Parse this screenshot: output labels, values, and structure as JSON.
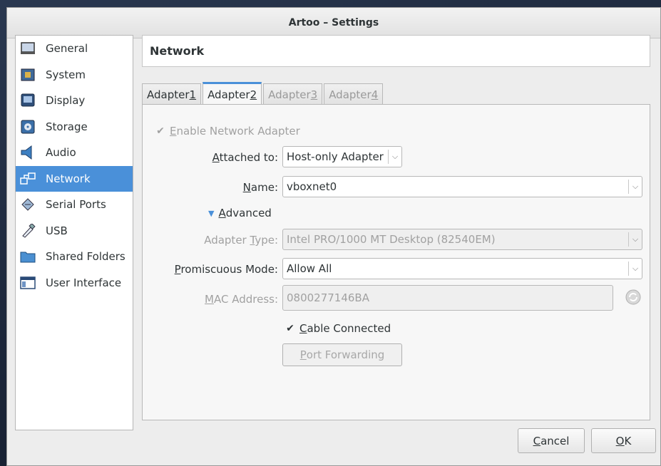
{
  "window": {
    "title": "Artoo – Settings"
  },
  "sidebar": {
    "items": [
      {
        "label": "General",
        "icon": "monitor-icon"
      },
      {
        "label": "System",
        "icon": "chip-icon"
      },
      {
        "label": "Display",
        "icon": "display-icon"
      },
      {
        "label": "Storage",
        "icon": "storage-icon"
      },
      {
        "label": "Audio",
        "icon": "speaker-icon"
      },
      {
        "label": "Network",
        "icon": "network-icon",
        "selected": true
      },
      {
        "label": "Serial Ports",
        "icon": "serial-port-icon"
      },
      {
        "label": "USB",
        "icon": "usb-icon"
      },
      {
        "label": "Shared Folders",
        "icon": "folder-icon"
      },
      {
        "label": "User Interface",
        "icon": "window-icon"
      }
    ]
  },
  "section": {
    "title": "Network"
  },
  "tabs": [
    {
      "pre": "Adapter ",
      "key": "1",
      "state": "normal"
    },
    {
      "pre": "Adapter ",
      "key": "2",
      "state": "active"
    },
    {
      "pre": "Adapter ",
      "key": "3",
      "state": "disabled"
    },
    {
      "pre": "Adapter ",
      "key": "4",
      "state": "disabled"
    }
  ],
  "form": {
    "enable": {
      "key": "E",
      "rest": "nable Network Adapter",
      "checked": true
    },
    "attached": {
      "pre": "",
      "key": "A",
      "post": "ttached to:",
      "value": "Host-only Adapter"
    },
    "name": {
      "pre": "",
      "key": "N",
      "post": "ame:",
      "value": "vboxnet0"
    },
    "advanced": {
      "pre": "",
      "key": "A",
      "post": "dvanced"
    },
    "adapter_type": {
      "pre": "Adapter ",
      "key": "T",
      "post": "ype:",
      "value": "Intel PRO/1000 MT Desktop (82540EM)"
    },
    "promiscuous": {
      "pre": "",
      "key": "P",
      "post": "romiscuous Mode:",
      "value": "Allow All"
    },
    "mac": {
      "pre": "",
      "key": "M",
      "post": "AC Address:",
      "value": "0800277146BA"
    },
    "cable": {
      "pre": "",
      "key": "C",
      "post": "able Connected",
      "checked": true
    },
    "port_forwarding": {
      "pre": "",
      "key": "P",
      "post": "ort Forwarding"
    }
  },
  "buttons": {
    "cancel": {
      "key": "C",
      "post": "ancel"
    },
    "ok": {
      "key": "O",
      "post": "K"
    }
  },
  "colors": {
    "accent": "#4a90d9",
    "window_bg": "#ededed"
  }
}
